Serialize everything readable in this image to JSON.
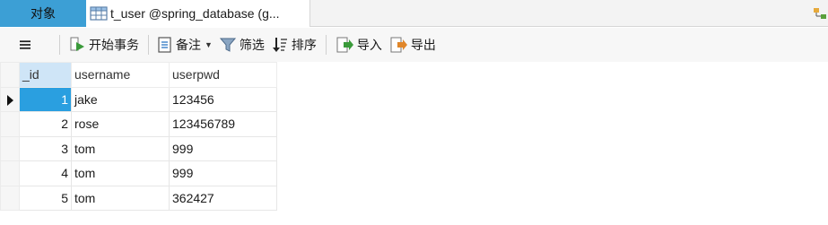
{
  "tabs": {
    "objects_label": "对象",
    "active_table_label": "t_user @spring_database (g..."
  },
  "toolbar": {
    "begin_transaction": "开始事务",
    "memo": "备注",
    "filter": "筛选",
    "sort": "排序",
    "import": "导入",
    "export": "导出"
  },
  "grid": {
    "columns": [
      "_id",
      "username",
      "userpwd"
    ],
    "rows": [
      {
        "id": "1",
        "username": "jake",
        "userpwd": "123456"
      },
      {
        "id": "2",
        "username": "rose",
        "userpwd": "123456789"
      },
      {
        "id": "3",
        "username": "tom",
        "userpwd": "999"
      },
      {
        "id": "4",
        "username": "tom",
        "userpwd": "999"
      },
      {
        "id": "5",
        "username": "tom",
        "userpwd": "362427"
      }
    ],
    "selected_row": 1
  },
  "colors": {
    "objects_tab": "#3c9fd5",
    "selected_cell": "#2a9fe0",
    "header_id": "#cfe5f7"
  }
}
